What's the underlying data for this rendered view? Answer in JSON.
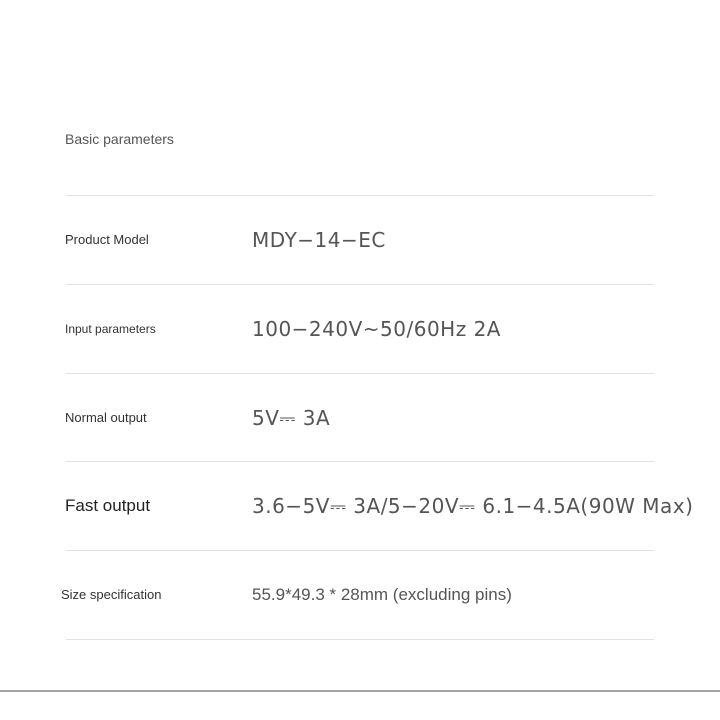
{
  "section": {
    "title": "Basic parameters"
  },
  "rows": [
    {
      "label": "Product Model",
      "value": "MDY−14−EC"
    },
    {
      "label": "Input parameters",
      "value": "100−240V~50/60Hz 2A"
    },
    {
      "label": "Normal output",
      "value": "5V⎓ 3A"
    },
    {
      "label": "Fast output",
      "value": "3.6−5V⎓ 3A/5−20V⎓ 6.1−4.5A(90W Max)"
    },
    {
      "label": "Size specification",
      "value": "55.9*49.3 * 28mm (excluding pins)"
    }
  ]
}
